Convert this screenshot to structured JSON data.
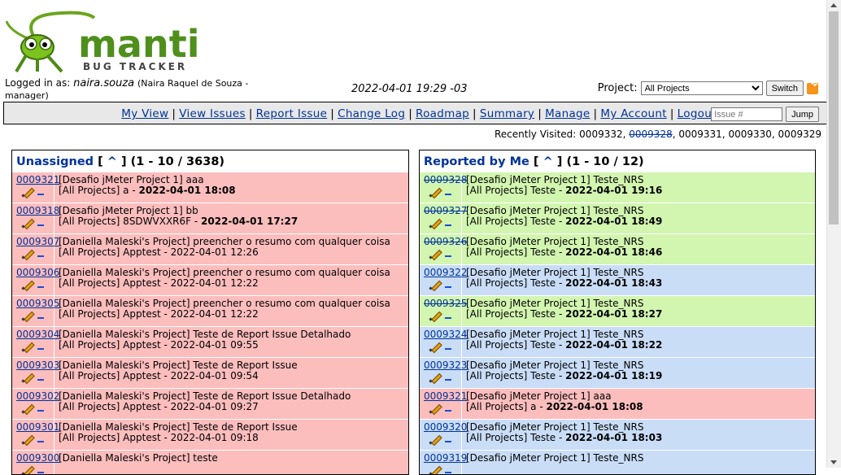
{
  "header": {
    "logged_in_label": "Logged in as:",
    "username": "naira.souza",
    "role": "(Naira Raquel de Souza - manager)",
    "datetime": "2022-04-01 19:29 -03",
    "project_label": "Project:",
    "project_selected": "All Projects",
    "switch_label": "Switch",
    "logo_main": "mantis",
    "logo_sub": "BUG TRACKER"
  },
  "menu": [
    {
      "label": "My View"
    },
    {
      "label": "View Issues"
    },
    {
      "label": "Report Issue"
    },
    {
      "label": "Change Log"
    },
    {
      "label": "Roadmap"
    },
    {
      "label": "Summary"
    },
    {
      "label": "Manage"
    },
    {
      "label": "My Account"
    },
    {
      "label": "Logout"
    }
  ],
  "jump": {
    "placeholder": "Issue #",
    "label": "Jump"
  },
  "recent": {
    "label": "Recently Visited:",
    "items": [
      "0009332",
      "0009328",
      "0009331",
      "0009330",
      "0009329"
    ]
  },
  "unassigned": {
    "title": "Unassigned",
    "caret": "^",
    "range": "(1 - 10 / 3638)",
    "rows": [
      {
        "id": "0009321",
        "summary": "[Desafio jMeter Project 1] aaa",
        "cat": "[All Projects] a",
        "date": "2022-04-01 18:08",
        "bold": true
      },
      {
        "id": "0009318",
        "summary": "[Desafio jMeter Project 1] bb",
        "cat": "[All Projects] 8SDWVXXR6F",
        "date": "2022-04-01 17:27",
        "bold": true
      },
      {
        "id": "0009307",
        "summary": "[Daniella Maleski's Project] preencher o resumo com qualquer coisa",
        "cat": "[All Projects] Apptest",
        "date": "2022-04-01 12:26",
        "bold": false
      },
      {
        "id": "0009306",
        "summary": "[Daniella Maleski's Project] preencher o resumo com qualquer coisa",
        "cat": "[All Projects] Apptest",
        "date": "2022-04-01 12:22",
        "bold": false
      },
      {
        "id": "0009305",
        "summary": "[Daniella Maleski's Project] preencher o resumo com qualquer coisa",
        "cat": "[All Projects] Apptest",
        "date": "2022-04-01 12:22",
        "bold": false
      },
      {
        "id": "0009304",
        "summary": "[Daniella Maleski's Project] Teste de Report Issue Detalhado",
        "cat": "[All Projects] Apptest",
        "date": "2022-04-01 09:55",
        "bold": false
      },
      {
        "id": "0009303",
        "summary": "[Daniella Maleski's Project] Teste de Report Issue",
        "cat": "[All Projects] Apptest",
        "date": "2022-04-01 09:54",
        "bold": false
      },
      {
        "id": "0009302",
        "summary": "[Daniella Maleski's Project] Teste de Report Issue Detalhado",
        "cat": "[All Projects] Apptest",
        "date": "2022-04-01 09:27",
        "bold": false
      },
      {
        "id": "0009301",
        "summary": "[Daniella Maleski's Project] Teste de Report Issue",
        "cat": "[All Projects] Apptest",
        "date": "2022-04-01 09:18",
        "bold": false
      },
      {
        "id": "0009300",
        "summary": "[Daniella Maleski's Project] teste",
        "cat": "",
        "date": "",
        "bold": false
      }
    ]
  },
  "reported": {
    "title": "Reported by Me",
    "caret": "^",
    "range": "(1 - 10 / 12)",
    "rows": [
      {
        "id": "0009328",
        "strike": true,
        "color": "green",
        "summary": "[Desafio jMeter Project 1] Teste_NRS",
        "cat": "[All Projects] Teste",
        "date": "2022-04-01 19:16"
      },
      {
        "id": "0009327",
        "strike": true,
        "color": "green",
        "summary": "[Desafio jMeter Project 1] Teste_NRS",
        "cat": "[All Projects] Teste",
        "date": "2022-04-01 18:49"
      },
      {
        "id": "0009326",
        "strike": true,
        "color": "green",
        "summary": "[Desafio jMeter Project 1] Teste_NRS",
        "cat": "[All Projects] Teste",
        "date": "2022-04-01 18:46"
      },
      {
        "id": "0009322",
        "strike": false,
        "color": "blue",
        "summary": "[Desafio jMeter Project 1] Teste_NRS",
        "cat": "[All Projects] Teste",
        "date": "2022-04-01 18:43"
      },
      {
        "id": "0009325",
        "strike": true,
        "color": "green",
        "summary": "[Desafio jMeter Project 1] Teste_NRS",
        "cat": "[All Projects] Teste",
        "date": "2022-04-01 18:27"
      },
      {
        "id": "0009324",
        "strike": false,
        "color": "blue",
        "summary": "[Desafio jMeter Project 1] Teste_NRS",
        "cat": "[All Projects] Teste",
        "date": "2022-04-01 18:22"
      },
      {
        "id": "0009323",
        "strike": false,
        "color": "blue",
        "summary": "[Desafio jMeter Project 1] Teste_NRS",
        "cat": "[All Projects] Teste",
        "date": "2022-04-01 18:19"
      },
      {
        "id": "0009321",
        "strike": false,
        "color": "red",
        "summary": "[Desafio jMeter Project 1] aaa",
        "cat": "[All Projects] a",
        "date": "2022-04-01 18:08"
      },
      {
        "id": "0009320",
        "strike": false,
        "color": "blue",
        "summary": "[Desafio jMeter Project 1] Teste_NRS",
        "cat": "[All Projects] Teste",
        "date": "2022-04-01 18:03"
      },
      {
        "id": "0009319",
        "strike": false,
        "color": "blue",
        "summary": "[Desafio jMeter Project 1] Teste_NRS",
        "cat": "",
        "date": ""
      }
    ]
  },
  "colors": {
    "red": "#fcbdbd",
    "green": "#d2f5b0",
    "blue": "#c9ddf7",
    "link": "#003399"
  }
}
